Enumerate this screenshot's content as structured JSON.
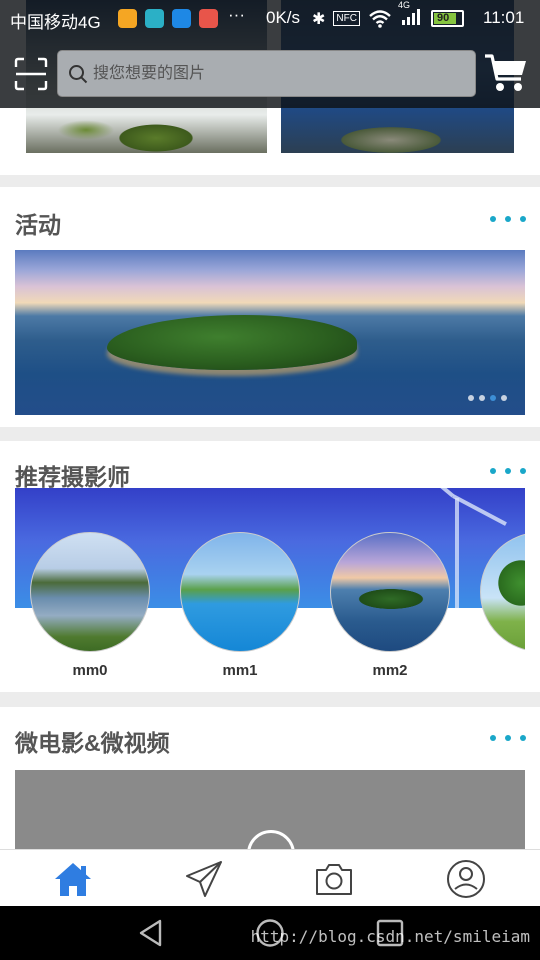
{
  "status_bar": {
    "carrier": "中国移动4G",
    "more": "···",
    "net_speed": "0K/s",
    "nfc": "NFC",
    "network": "4G",
    "battery": "90",
    "time": "11:01",
    "app_icon_colors": [
      "#f5a623",
      "#2bb0c6",
      "#1e88e5",
      "#e8554a"
    ]
  },
  "header": {
    "search_placeholder": "搜您想要的图片"
  },
  "sections": {
    "activity": {
      "title": "活动"
    },
    "photographers": {
      "title": "推荐摄影师",
      "items": [
        {
          "name": "mm0"
        },
        {
          "name": "mm1"
        },
        {
          "name": "mm2"
        }
      ]
    },
    "film": {
      "title": "微电影&微视频"
    }
  },
  "banner": {
    "dot_count": 4,
    "active_index": 2
  },
  "tabs": [
    "home",
    "discover",
    "camera",
    "profile"
  ],
  "colors": {
    "accent": "#1aa7c9",
    "tab_active": "#2f7de1",
    "tab_inactive": "#444444"
  },
  "watermark": "http://blog.csdn.net/smileiam"
}
